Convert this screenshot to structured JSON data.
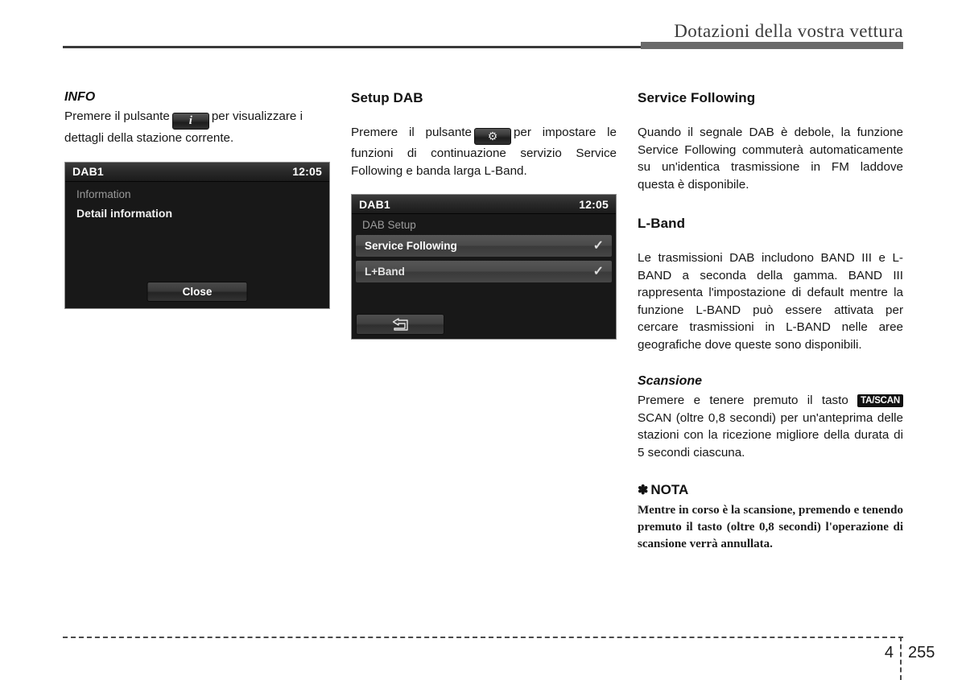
{
  "header": {
    "title": "Dotazioni della vostra vettura"
  },
  "column_left": {
    "info": {
      "title": "INFO",
      "text_before": "Premere il pulsante",
      "button_icon": "info-i-icon",
      "text_after": "per visualizzare i dettagli della stazione corrente."
    },
    "screen": {
      "source": "DAB1",
      "clock": "12:05",
      "subtitle": "Information",
      "detail": "Detail information",
      "close_label": "Close"
    }
  },
  "column_middle": {
    "setup": {
      "title": "Setup DAB",
      "text_before": "Premere il pulsante",
      "button_icon": "gear-icon",
      "text_after": "per impostare le funzioni di continuazione servizio Service Following e banda larga L-Band."
    },
    "screen": {
      "source": "DAB1",
      "clock": "12:05",
      "subtitle": "DAB Setup",
      "rows": [
        {
          "label": "Service Following",
          "checked": true
        },
        {
          "label": "L+Band",
          "checked": true
        }
      ],
      "back_icon": "back-arrow-icon"
    }
  },
  "column_right": {
    "service_following": {
      "title": "Service Following",
      "body": "Quando il segnale DAB è debole, la funzione Service Following commuterà automaticamente su un'identica trasmissione in FM laddove questa è disponibile."
    },
    "l_band": {
      "title": "L-Band",
      "body": "Le trasmissioni DAB includono BAND III e L-BAND a seconda della gamma. BAND III rappresenta l'impostazione di default mentre la funzione L-BAND può essere attivata per cercare trasmissioni in L-BAND nelle aree geografiche dove queste sono disponibili."
    },
    "scansione": {
      "title": "Scansione",
      "text_before": "Premere e tenere premuto il tasto",
      "badge": "TA/SCAN",
      "text_after": "SCAN (oltre 0,8 secondi) per un'anteprima delle stazioni con la ricezione migliore della durata di 5 secondi ciascuna."
    },
    "nota": {
      "star": "✽",
      "title": "NOTA",
      "body": "Mentre in corso è la scansione, premendo e tenendo premuto il tasto (oltre 0,8 secondi) l'operazione di scansione verrà annullata."
    }
  },
  "footer": {
    "chapter": "4",
    "page": "255"
  }
}
